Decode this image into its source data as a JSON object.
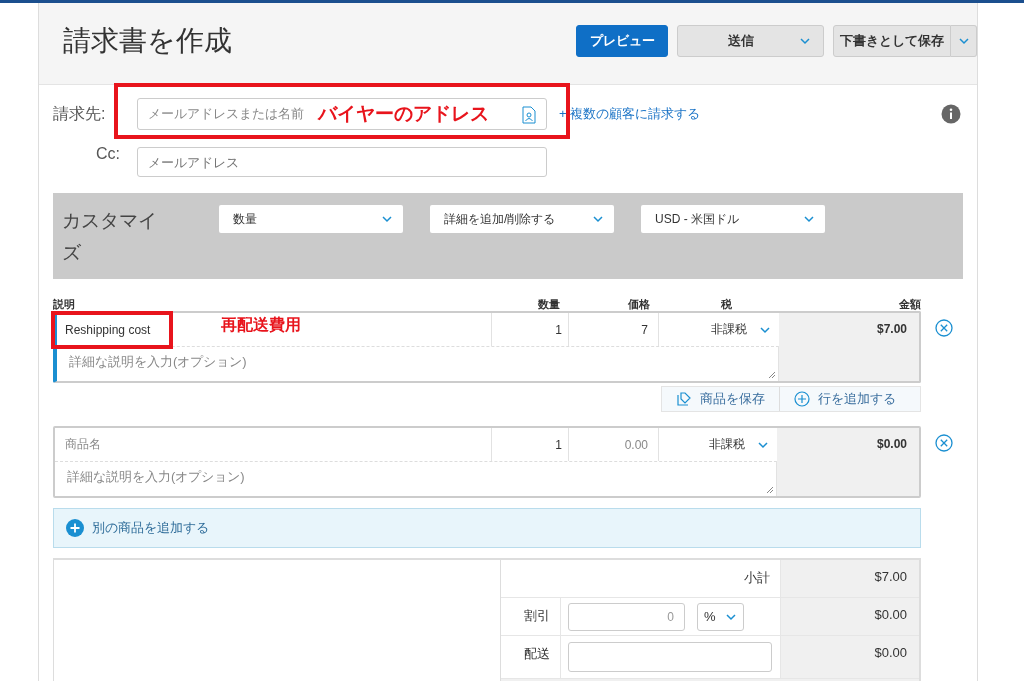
{
  "header": {
    "title": "請求書を作成",
    "buttons": [
      {
        "label": "プレビュー",
        "kind": "primary"
      },
      {
        "label": "送信",
        "kind": "dropdown"
      },
      {
        "label": "下書きとして保存",
        "kind": "split"
      }
    ]
  },
  "recipient": {
    "label": "請求先:",
    "placeholder": "メールアドレスまたは名前",
    "annotation": "バイヤーのアドレス",
    "link": "+ 複数の顧客に請求する"
  },
  "cc": {
    "label": "Cc:",
    "placeholder": "メールアドレス"
  },
  "customize": {
    "label": "カスタマイズ",
    "selects": [
      "数量",
      "詳細を追加/削除する",
      "USD - 米国ドル"
    ]
  },
  "items": {
    "columns": [
      "説明",
      "数量",
      "価格",
      "税",
      "金額"
    ],
    "rows": [
      {
        "active": true,
        "name": "Reshipping cost",
        "annotation": "再配送費用",
        "quantity": "1",
        "price": "7",
        "detail_placeholder": "詳細な説明を入力(オプション)",
        "tax": "非課税",
        "amount": "$7.00",
        "actions": [
          "商品を保存",
          "行を追加する"
        ]
      },
      {
        "active": false,
        "name_placeholder": "商品名",
        "quantity": "1",
        "price_placeholder": "0.00",
        "detail_placeholder": "詳細な説明を入力(オプション)",
        "tax": "非課税",
        "amount": "$0.00"
      }
    ]
  },
  "add_item": "別の商品を追加する",
  "totals": [
    {
      "kind": "plain",
      "label": "小計",
      "amount": "$7.00"
    },
    {
      "kind": "discount",
      "label": "割引",
      "placeholder": "0",
      "unit": "%",
      "amount": "$0.00"
    },
    {
      "kind": "input",
      "label": "配送",
      "amount": "$0.00"
    }
  ]
}
